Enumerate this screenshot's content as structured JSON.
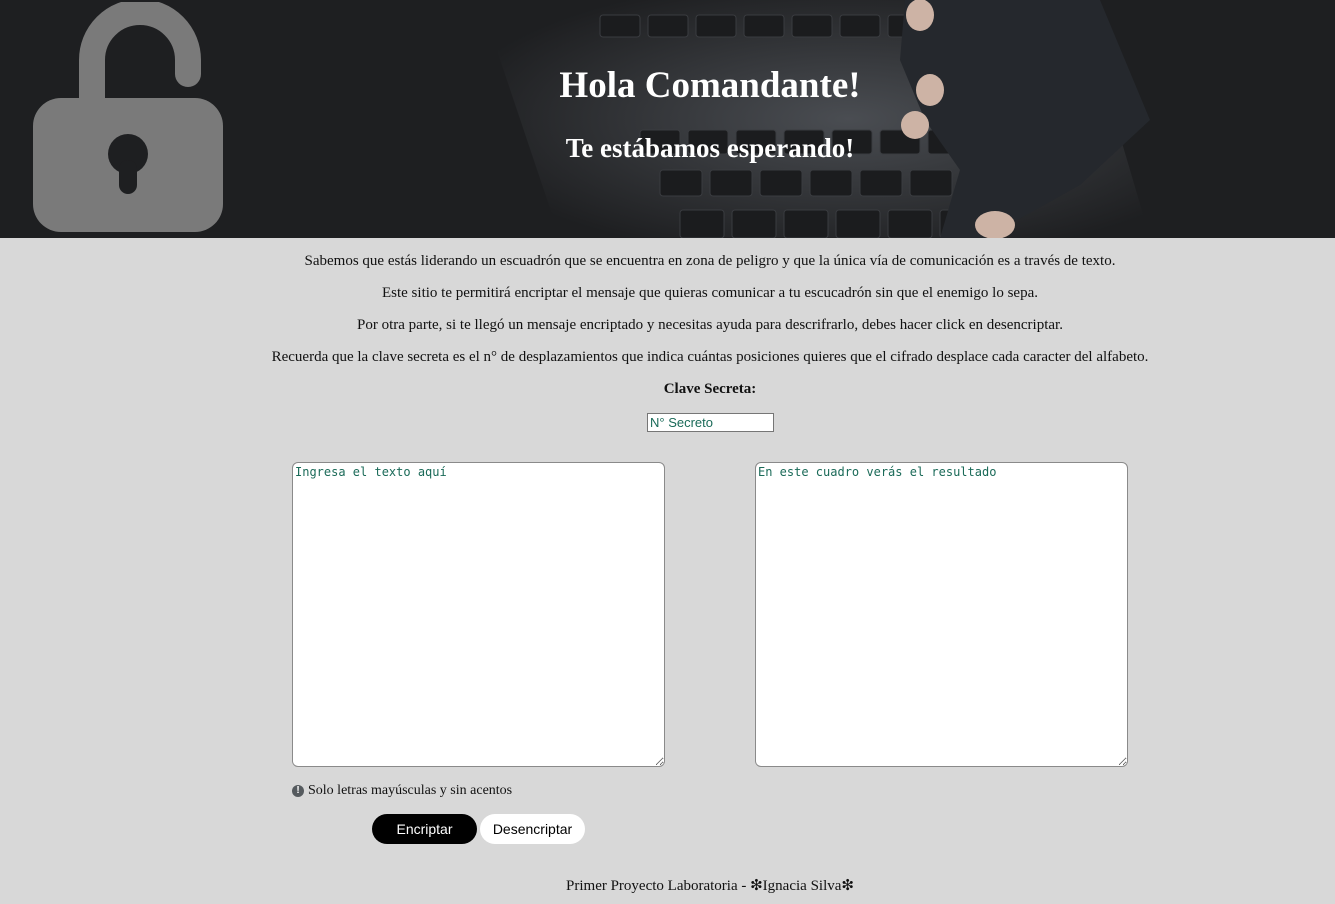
{
  "hero": {
    "title": "Hola Comandante!",
    "subtitle": "Te estábamos esperando!",
    "icon": "unlocked-padlock-icon"
  },
  "intro": {
    "line1": "Sabemos que estás liderando un escuadrón que se encuentra en zona de peligro y que la única vía de comunicación es a través de texto.",
    "line2": "Este sitio te permitirá encriptar el mensaje que quieras comunicar a tu escucadrón sin que el enemigo lo sepa.",
    "line3": "Por otra parte, si te llegó un mensaje encriptado y necesitas ayuda para descrifrarlo, debes hacer click en desencriptar.",
    "line4": "Recuerda que la clave secreta es el n° de desplazamientos que indica cuántas posiciones quieres que el cifrado desplace cada caracter del alfabeto."
  },
  "key": {
    "label": "Clave Secreta:",
    "placeholder": "N° Secreto",
    "value": ""
  },
  "input_text": {
    "placeholder": "Ingresa el texto aquí",
    "value": ""
  },
  "output_text": {
    "placeholder": "En este cuadro verás el resultado",
    "value": ""
  },
  "warning": {
    "icon": "exclamation-circle-icon",
    "text": "Solo letras mayúsculas y sin acentos"
  },
  "buttons": {
    "encrypt": "Encriptar",
    "decrypt": "Desencriptar"
  },
  "footer": {
    "text": "Primer Proyecto Laboratoria - ❇Ignacia Silva❇"
  },
  "colors": {
    "page_bg": "#d8d8d8",
    "hero_bg": "#1e1f21",
    "placeholder_text": "#1a6a58",
    "encrypt_bg": "#000000",
    "decrypt_bg": "#ffffff"
  }
}
